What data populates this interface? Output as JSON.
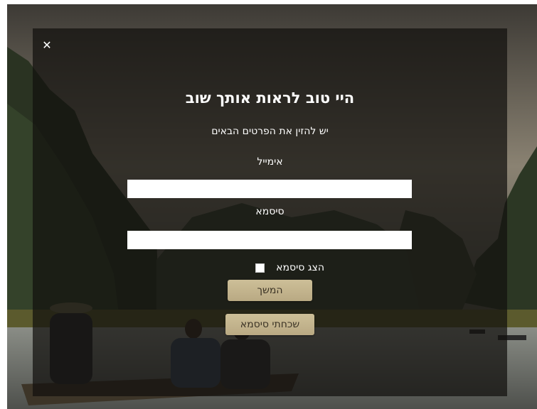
{
  "modal": {
    "close_icon": "close-icon",
    "close_glyph": "✕",
    "title": "היי טוב לראות אותך שוב",
    "subtitle": "יש להזין את הפרטים הבאים",
    "email": {
      "label": "אימייל",
      "value": "",
      "placeholder": ""
    },
    "password": {
      "label": "סיסמא",
      "value": "",
      "placeholder": ""
    },
    "show_password": {
      "label": "הצג סיסמא",
      "checked": false
    },
    "continue_label": "המשך",
    "forgot_label": "שכחתי סיסמא"
  },
  "colors": {
    "overlay": "#12100e",
    "button": "#c4b58f",
    "button_text": "#3a3224"
  }
}
